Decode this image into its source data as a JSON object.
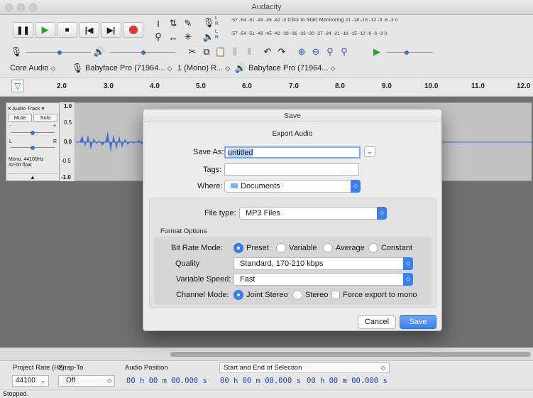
{
  "app": {
    "title": "Audacity"
  },
  "transport": {
    "record_color": "#e0362e",
    "play_color": "#2aa12a"
  },
  "meters": {
    "record_scale": "-57 -54 -51 -48 -45 -42 -3",
    "record_hint": "Click to Start Monitoring",
    "record_scale_tail": "21 -18 -15 -12 -9 -6 -3 0",
    "play_scale": "-57 -54 -51 -48 -45 -42 -39 -36 -33 -30 -27 -24 -21 -18 -15 -12 -9 -6 -3 0",
    "L": "L",
    "R": "R"
  },
  "devices": {
    "host": "Core Audio",
    "input": "Babyface Pro (71964...",
    "channels": "1 (Mono) R...",
    "output": "Babyface Pro (71964..."
  },
  "ruler": {
    "ticks": [
      "2.0",
      "3.0",
      "4.0",
      "5.0",
      "6.0",
      "7.0",
      "8.0",
      "9.0",
      "10.0",
      "11.0",
      "12.0"
    ]
  },
  "track": {
    "name": "Audio Track",
    "mute": "Mute",
    "solo": "Solo",
    "gain_minus": "-",
    "gain_plus": "+",
    "pan_l": "L",
    "pan_r": "R",
    "info1": "Mono, 44100Hz",
    "info2": "32-bit float",
    "scale": [
      "1.0",
      "0.5",
      "0.0",
      "-0.5",
      "-1.0"
    ],
    "wave_color": "#3f6fd1"
  },
  "dialog": {
    "title": "Save",
    "subtitle": "Export Audio",
    "save_as_label": "Save As:",
    "save_as_value": "untitled",
    "tags_label": "Tags:",
    "tags_value": "",
    "where_label": "Where:",
    "where_value": "Documents",
    "file_type_label": "File type:",
    "file_type_value": "MP3 Files",
    "format_options_label": "Format Options",
    "bit_rate_label": "Bit Rate Mode:",
    "bit_rate_options": [
      "Preset",
      "Variable",
      "Average",
      "Constant"
    ],
    "bit_rate_selected": "Preset",
    "quality_label": "Quality",
    "quality_value": "Standard, 170-210 kbps",
    "var_speed_label": "Variable Speed:",
    "var_speed_value": "Fast",
    "channel_mode_label": "Channel Mode:",
    "channel_options": [
      "Joint Stereo",
      "Stereo"
    ],
    "channel_selected": "Joint Stereo",
    "force_mono_label": "Force export to mono",
    "force_mono_checked": false,
    "cancel_label": "Cancel",
    "save_label": "Save",
    "accent": "#3a7ff0"
  },
  "selection_bar": {
    "project_rate_label": "Project Rate (Hz):",
    "project_rate_value": "44100",
    "snap_label": "Snap-To",
    "snap_value": "Off",
    "audio_position_label": "Audio Position",
    "selection_mode": "Start and End of Selection",
    "audio_position": "00 h 00 m 00.000 s",
    "sel_start": "00 h 00 m 00.000 s",
    "sel_end": "00 h 00 m 00.000 s"
  },
  "status": {
    "text": "Stopped."
  }
}
